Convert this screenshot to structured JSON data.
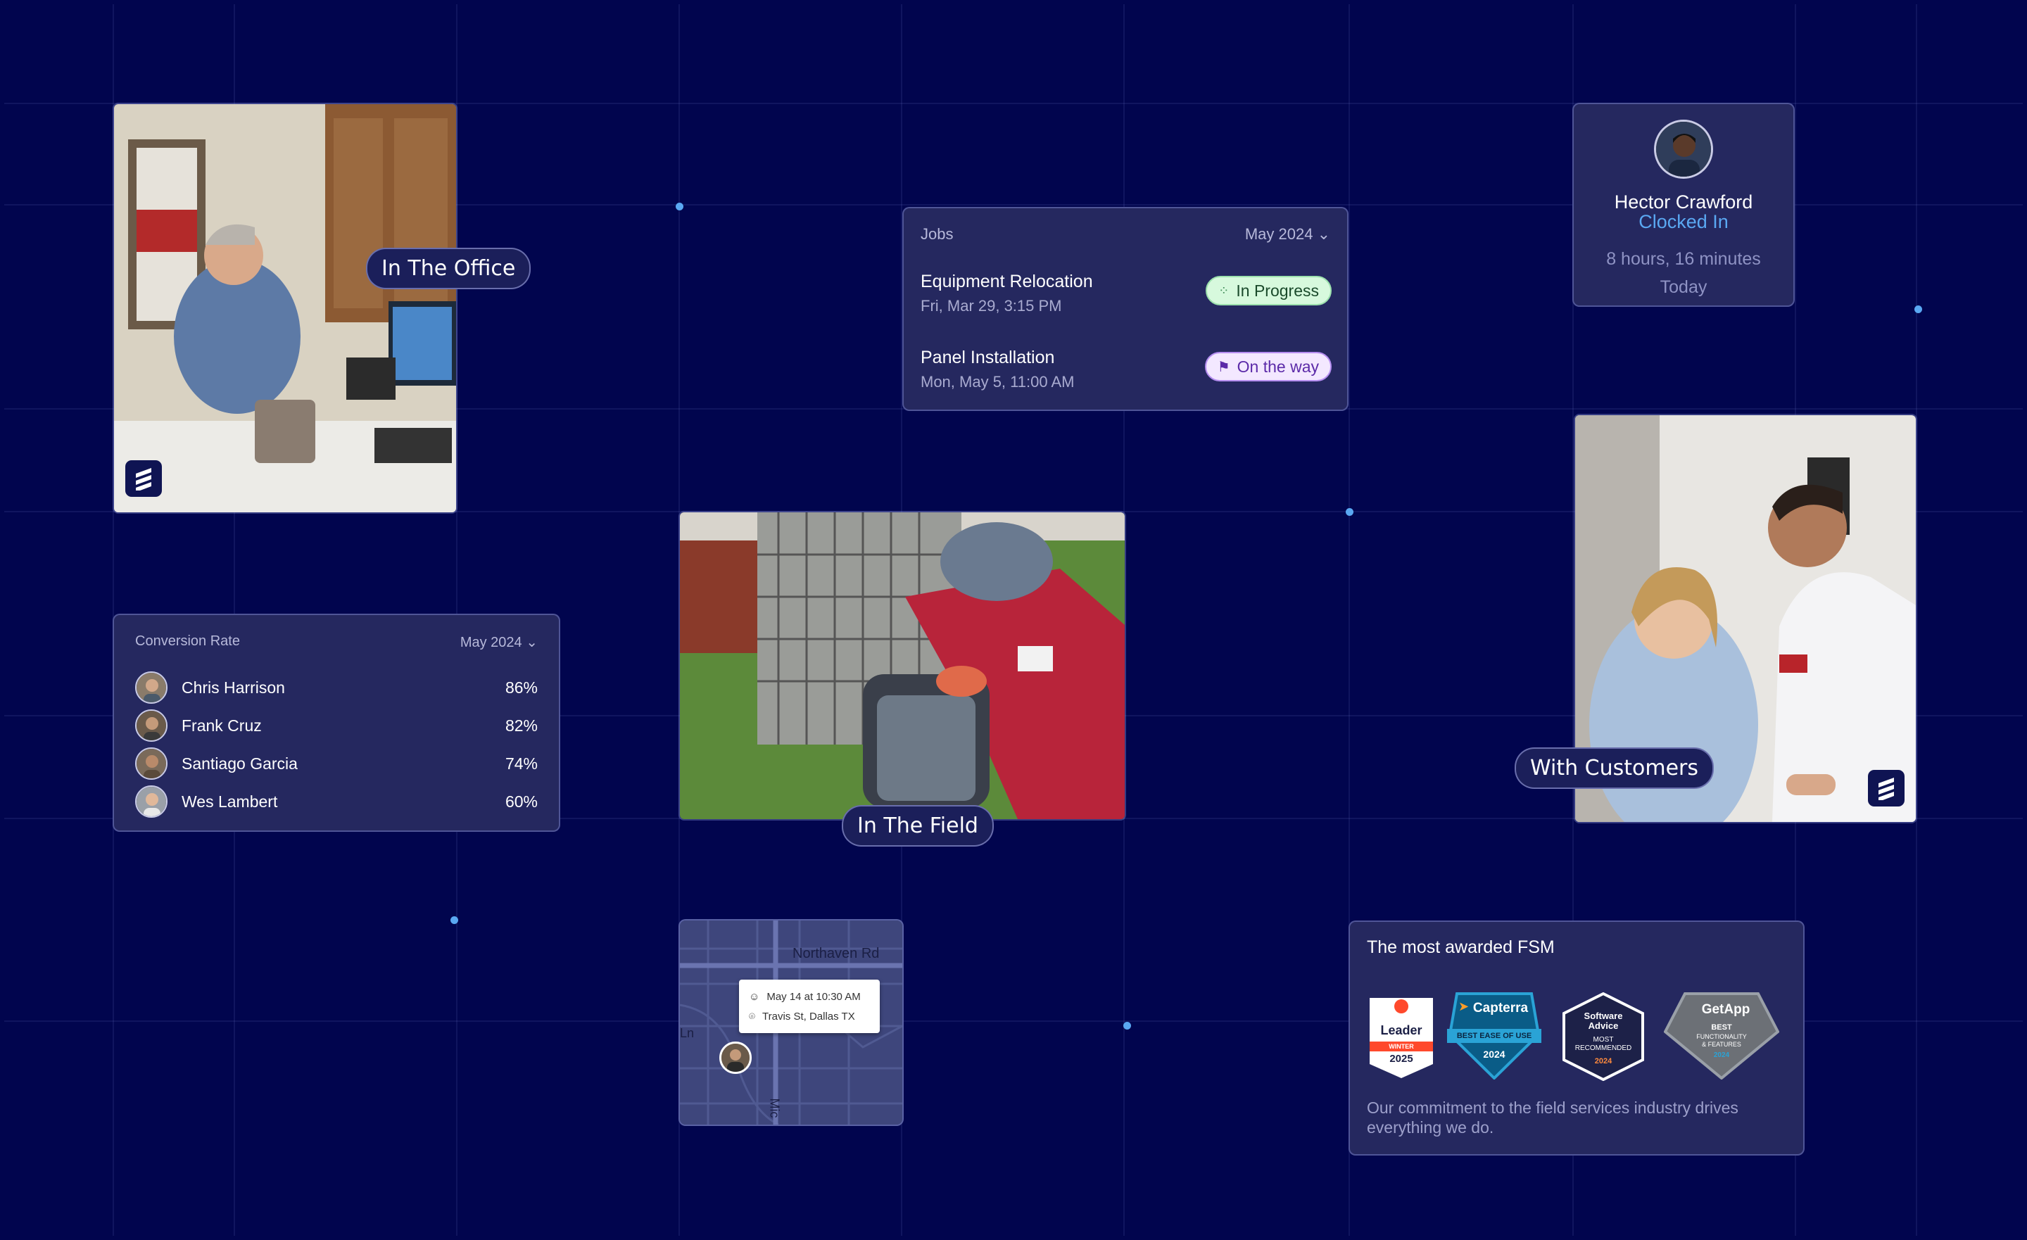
{
  "labels": {
    "office": "In The Office",
    "field": "In The Field",
    "customers": "With Customers"
  },
  "jobs": {
    "title": "Jobs",
    "period": "May 2024",
    "items": [
      {
        "title": "Equipment Relocation",
        "time": "Fri, Mar 29, 3:15 PM",
        "status": "In Progress"
      },
      {
        "title": "Panel Installation",
        "time": "Mon, May 5, 11:00 AM",
        "status": "On the way"
      }
    ]
  },
  "conversion": {
    "title": "Conversion Rate",
    "period": "May 2024",
    "rows": [
      {
        "name": "Chris Harrison",
        "value": "86%"
      },
      {
        "name": "Frank Cruz",
        "value": "82%"
      },
      {
        "name": "Santiago Garcia",
        "value": "74%"
      },
      {
        "name": "Wes Lambert",
        "value": "60%"
      }
    ]
  },
  "clock": {
    "name": "Hector Crawford",
    "status": "Clocked In",
    "duration": "8 hours, 16 minutes",
    "day": "Today"
  },
  "map": {
    "street": "Northaven Rd",
    "street_left": "Ln",
    "street_bottom": "Mic",
    "popup_time": "May 14 at 10:30 AM",
    "popup_address": "Travis St, Dallas TX"
  },
  "awards": {
    "title": "The most awarded FSM",
    "description": "Our commitment to the field services industry drives everything we do.",
    "badges": [
      {
        "name": "g2",
        "line1": "Leader",
        "line2": "WINTER",
        "line3": "2025"
      },
      {
        "name": "capterra",
        "line1": "Capterra",
        "line2": "BEST EASE OF USE",
        "line3": "2024"
      },
      {
        "name": "software-advice",
        "line1": "Software",
        "line1b": "Advice",
        "line2": "MOST",
        "line2b": "RECOMMENDED",
        "line3": "2024"
      },
      {
        "name": "getapp",
        "line1": "GetApp",
        "line2": "BEST",
        "line2b": "FUNCTIONALITY",
        "line2c": "& FEATURES",
        "line3": "2024"
      }
    ]
  },
  "colors": {
    "background": "#01054e",
    "card": "#25285f",
    "accent": "#5aa8f2",
    "in_progress": "#d7f9dd",
    "on_the_way": "#f3e8ff"
  }
}
